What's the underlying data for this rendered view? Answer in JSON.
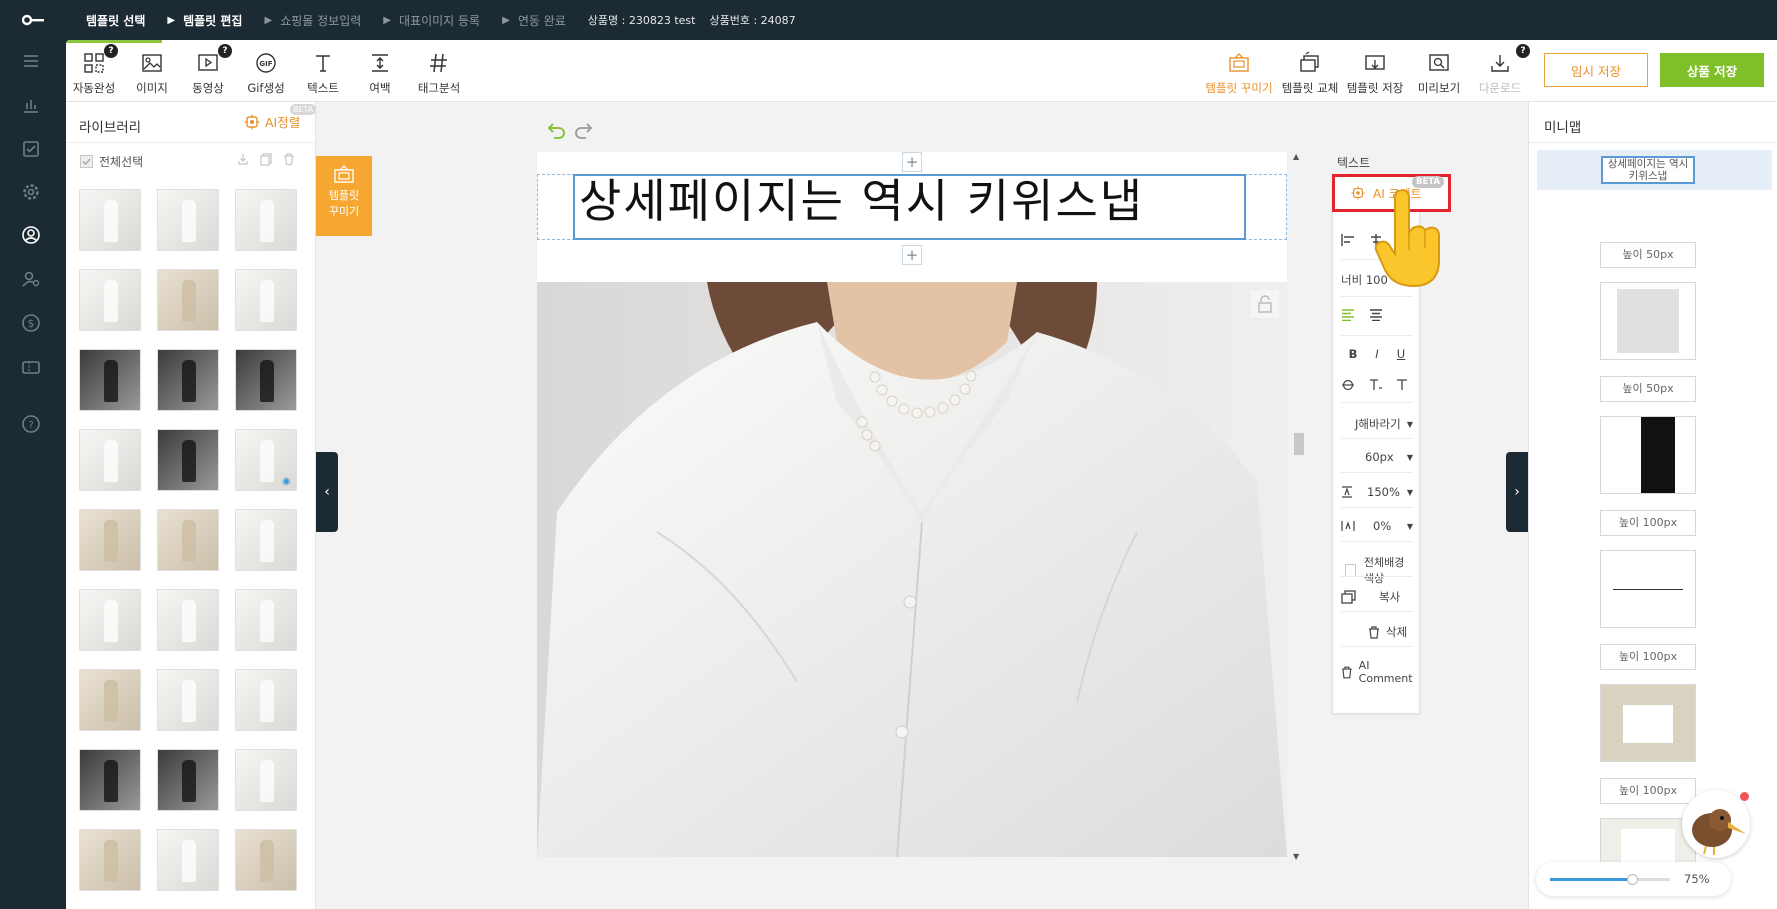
{
  "steps": [
    {
      "label": "템플릿 선택",
      "active": true
    },
    {
      "label": "템플릿 편집",
      "active": true
    },
    {
      "label": "쇼핑몰 정보입력",
      "active": false
    },
    {
      "label": "대표이미지 등록",
      "active": false
    },
    {
      "label": "연동 완료",
      "active": false
    }
  ],
  "meta": {
    "product_name": "상품명 : 230823 test",
    "product_no": "상품번호 : 24087"
  },
  "toolbar": {
    "tools": [
      {
        "label": "자동완성",
        "icon": "auto-complete-icon"
      },
      {
        "label": "이미지",
        "icon": "image-icon"
      },
      {
        "label": "동영상",
        "icon": "video-icon"
      },
      {
        "label": "Gif생성",
        "icon": "gif-icon"
      },
      {
        "label": "텍스트",
        "icon": "text-icon"
      },
      {
        "label": "여백",
        "icon": "spacing-icon"
      },
      {
        "label": "태그분석",
        "icon": "hashtag-icon"
      }
    ],
    "right_tools": [
      {
        "label": "템플릿 꾸미기",
        "icon": "template-decorate-icon"
      },
      {
        "label": "템플릿 교체",
        "icon": "template-swap-icon"
      },
      {
        "label": "템플릿 저장",
        "icon": "template-save-icon"
      },
      {
        "label": "미리보기",
        "icon": "preview-icon"
      },
      {
        "label": "다운로드",
        "icon": "download-icon"
      }
    ],
    "help_badge": "?",
    "temp_save": "임시 저장",
    "product_save": "상품 저장"
  },
  "library": {
    "title": "라이브러리",
    "ai_sort": "AI정렬",
    "beta": "BETA",
    "select_all": "전체선택"
  },
  "deco_tab": {
    "line1": "템플릿",
    "line2": "꾸미기"
  },
  "canvas": {
    "headline": "상세페이지는 역시 키위스냅",
    "add_symbol": "+"
  },
  "props": {
    "title": "텍스트",
    "ai_copy": "AI 코멘트",
    "beta": "BETA",
    "width": "너비 100",
    "bold": "B",
    "italic": "I",
    "underline": "U",
    "font": "J해바라기",
    "font_size": "60px",
    "line_height": "150%",
    "letter_spacing": "0%",
    "bg_all": "전체배경색상",
    "copy": "복사",
    "delete": "삭제",
    "ai_comment": "AI Comment"
  },
  "minimap": {
    "title": "미니맵",
    "text_block": "상세페이지는 역시 키위스냅",
    "labels": [
      "높이 50px",
      "높이 50px",
      "높이 100px",
      "높이 100px",
      "높이 100px"
    ]
  },
  "zoom": {
    "value": "75%",
    "level": 0.68
  },
  "colors": {
    "accent_green": "#7fbf2a",
    "accent_orange": "#e8912c",
    "dark": "#1c2b33",
    "select_blue": "#5b9bd5",
    "highlight_red": "#e5232f"
  }
}
